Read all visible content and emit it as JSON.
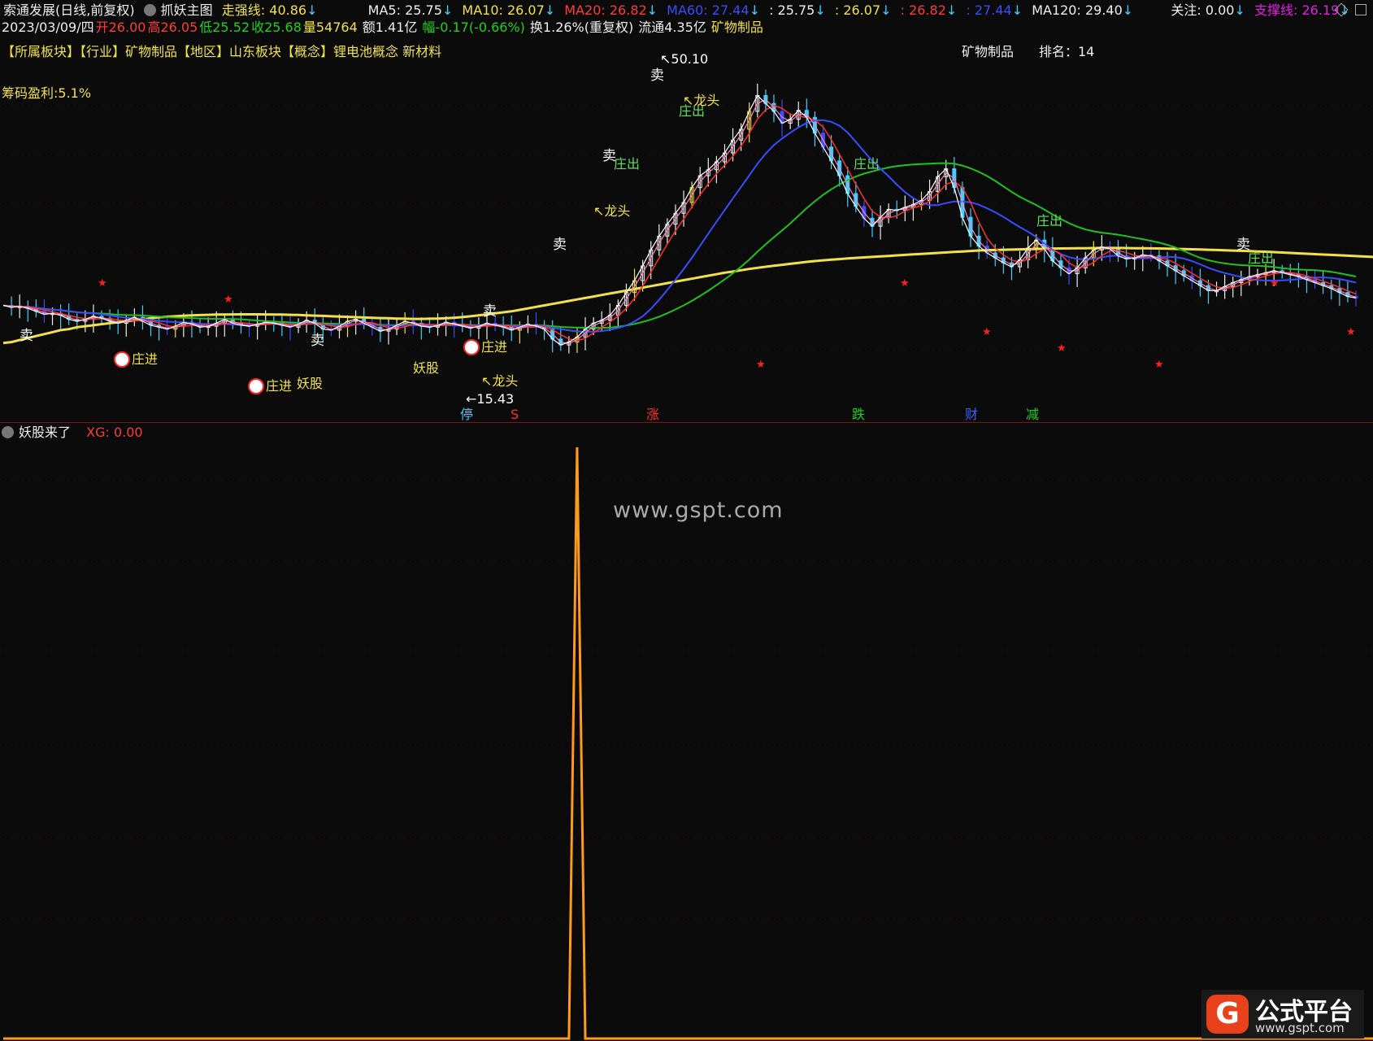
{
  "header": {
    "title": "索通发展(日线,前复权)",
    "indicator": "抓妖主图",
    "strong_line": {
      "label": "走强线: 40.86",
      "arrow": "↓"
    },
    "ma5": {
      "label": "MA5: 25.75",
      "arrow": "↓"
    },
    "ma10": {
      "label": "MA10: 26.07",
      "arrow": "↓"
    },
    "ma20": {
      "label": "MA20: 26.82",
      "arrow": "↓"
    },
    "ma60": {
      "label": "MA60: 27.44",
      "arrow": "↓"
    },
    "v1": {
      "label": ": 25.75",
      "arrow": "↓"
    },
    "v2": {
      "label": ": 26.07",
      "arrow": "↓"
    },
    "v3": {
      "label": ": 26.82",
      "arrow": "↓"
    },
    "v4": {
      "label": ": 27.44",
      "arrow": "↓"
    },
    "ma120": {
      "label": "MA120: 29.40",
      "arrow": "↓"
    },
    "focus": {
      "label": "关注: 0.00",
      "arrow": "↓"
    },
    "support": {
      "label": "支撑线: 26.19",
      "arrow": "↓"
    }
  },
  "quote": {
    "date": "2023/03/09/四",
    "open": "开26.00",
    "high": "高26.05",
    "low": "低25.52",
    "close": "收25.68",
    "volume": "量54764",
    "amount": "额1.41亿",
    "change": "幅-0.17(-0.66%)",
    "turnover": "换1.26%(重复权)",
    "float_cap": "流通4.35亿",
    "sector": "矿物制品"
  },
  "info": {
    "line": "【所属板块】【行业】矿物制品【地区】山东板块【概念】锂电池概念 新材料",
    "industry": "矿物制品",
    "rank": "排名：14",
    "chip_profit": "筹码盈利:5.1%"
  },
  "annotations": {
    "high_price": "50.10",
    "low_price": "15.43",
    "sell": "卖",
    "dealer_in": "庄进",
    "dealer_out": "庄出",
    "dragon_head": "龙头",
    "monster": "妖股",
    "bottom_markers": [
      "停",
      "S",
      "涨",
      "跌",
      "财",
      "减"
    ]
  },
  "sub_panel": {
    "name": "妖股来了",
    "value_label": "XG: 0.00"
  },
  "watermark": "www.gspt.com",
  "logo": {
    "name": "公式平台",
    "url": "www.gspt.com"
  },
  "colors": {
    "up": "#ff3b3b",
    "down": "#40d0ff",
    "ma5": "#ffffff",
    "ma10": "#f2e14a",
    "ma20": "#ff3030",
    "ma60": "#3a4cff",
    "ma120": "#20c020",
    "strong": "#f2e14a",
    "signal": "#ff9a1a"
  },
  "chart_data": [
    {
      "type": "line",
      "name": "price",
      "series": [
        {
          "name": "MA5",
          "values": [
            25.0,
            24.8,
            24.9,
            24.7,
            24.4,
            24.1,
            24.2,
            24.0,
            23.6,
            23.4,
            23.6,
            23.9,
            23.7,
            23.4,
            23.2,
            23.5,
            23.8,
            23.4,
            23.0,
            22.8,
            22.6,
            22.9,
            23.3,
            23.1,
            22.8,
            22.9,
            23.2,
            23.6,
            23.2,
            23.0,
            22.9,
            23.1,
            23.3,
            23.2,
            23.0,
            22.8,
            23.1,
            23.5,
            23.2,
            22.6,
            22.5,
            22.9,
            23.4,
            23.6,
            23.2,
            22.8,
            22.4,
            22.6,
            23.0,
            23.4,
            23.2,
            22.9,
            22.8,
            23.0,
            23.3,
            23.1,
            22.9,
            22.7,
            22.9,
            23.2,
            23.0,
            22.8,
            22.5,
            22.8,
            23.1,
            22.9,
            22.6,
            21.6,
            21.0,
            21.3,
            21.8,
            22.6,
            23.2,
            23.5,
            24.0,
            25.0,
            26.3,
            27.5,
            29.0,
            30.6,
            32.0,
            33.2,
            34.3,
            35.4,
            36.9,
            38.1,
            38.7,
            39.5,
            40.4,
            41.7,
            42.8,
            44.6,
            46.2,
            45.4,
            44.6,
            43.4,
            43.8,
            44.7,
            44.0,
            42.4,
            41.0,
            39.6,
            38.1,
            36.3,
            35.0,
            33.8,
            33.0,
            33.9,
            34.7,
            34.6,
            34.9,
            35.2,
            35.6,
            36.5,
            38.0,
            38.8,
            36.9,
            33.9,
            32.0,
            31.0,
            30.3,
            29.8,
            29.3,
            28.9,
            29.6,
            30.8,
            31.6,
            30.7,
            29.5,
            28.8,
            28.2,
            28.8,
            29.8,
            30.6,
            30.9,
            30.7,
            30.0,
            29.7,
            29.8,
            30.1,
            30.0,
            29.5,
            29.0,
            28.5,
            28.0,
            27.5,
            27.0,
            26.5,
            26.5,
            26.9,
            27.3,
            27.6,
            27.9,
            28.1,
            28.3,
            28.5,
            28.3,
            28.1,
            27.9,
            27.6,
            27.3,
            27.0,
            26.7,
            26.3,
            25.9,
            25.75
          ]
        },
        {
          "name": "MA120",
          "values": [
            21.2,
            21.3,
            21.5,
            21.7,
            21.9,
            22.1,
            22.3,
            22.5,
            22.6,
            22.8,
            22.9,
            23.0,
            23.1,
            23.2,
            23.3,
            23.4,
            23.5,
            23.6,
            23.7,
            23.8,
            23.85,
            23.9,
            23.95,
            24.0,
            24.02,
            24.05,
            24.07,
            24.08,
            24.09,
            24.1,
            24.1,
            24.1,
            24.09,
            24.08,
            24.07,
            24.05,
            24.03,
            24.0,
            23.97,
            23.94,
            23.9,
            23.87,
            23.84,
            23.81,
            23.78,
            23.75,
            23.72,
            23.7,
            23.67,
            23.65,
            23.64,
            23.64,
            23.65,
            23.67,
            23.7,
            23.75,
            23.82,
            23.9,
            24.0,
            24.1,
            24.2,
            24.3,
            24.4,
            24.55,
            24.7,
            24.85,
            25.0,
            25.15,
            25.3,
            25.45,
            25.6,
            25.75,
            25.9,
            26.05,
            26.2,
            26.35,
            26.5,
            26.65,
            26.8,
            26.95,
            27.1,
            27.25,
            27.4,
            27.55,
            27.7,
            27.85,
            28.0,
            28.15,
            28.3,
            28.42,
            28.55,
            28.68,
            28.8,
            28.9,
            29.0,
            29.1,
            29.2,
            29.3,
            29.4,
            29.48,
            29.55,
            29.62,
            29.68,
            29.74,
            29.8,
            29.85,
            29.9,
            29.95,
            30.0,
            30.05,
            30.1,
            30.15,
            30.2,
            30.25,
            30.3,
            30.35,
            30.4,
            30.45,
            30.5,
            30.55,
            30.58,
            30.6,
            30.62,
            30.64,
            30.66,
            30.68,
            30.7,
            30.72,
            30.74,
            30.75,
            30.76,
            30.77,
            30.78,
            30.79,
            30.8,
            30.8,
            30.8,
            30.79,
            30.78,
            30.77,
            30.76,
            30.75,
            30.73,
            30.71,
            30.69,
            30.67,
            30.65,
            30.62,
            30.6,
            30.57,
            30.54,
            30.51,
            30.48,
            30.45,
            30.42,
            30.38,
            30.34,
            30.3,
            30.26,
            30.22,
            30.18,
            30.14,
            30.1,
            30.06,
            30.02,
            29.98,
            29.94,
            29.9,
            29.86,
            29.82,
            29.78,
            29.74,
            29.7
          ]
        }
      ],
      "y_range": [
        15.43,
        50.1
      ]
    },
    {
      "type": "line",
      "name": "妖股来了",
      "series": [
        {
          "name": "XG",
          "values": [
            0,
            0,
            0,
            0,
            0,
            0,
            0,
            0,
            0,
            0,
            0,
            0,
            0,
            0,
            0,
            0,
            0,
            0,
            0,
            0,
            0,
            0,
            0,
            0,
            0,
            0,
            0,
            0,
            0,
            0,
            0,
            0,
            0,
            0,
            0,
            0,
            0,
            0,
            0,
            0,
            0,
            0,
            0,
            0,
            0,
            0,
            0,
            0,
            0,
            0,
            0,
            0,
            0,
            0,
            0,
            0,
            0,
            0,
            0,
            0,
            0,
            0,
            0,
            0,
            0,
            0,
            0,
            0,
            0,
            0,
            1,
            0,
            0,
            0,
            0,
            0,
            0,
            0,
            0,
            0,
            0,
            0,
            0,
            0,
            0,
            0,
            0,
            0,
            0,
            0,
            0,
            0,
            0,
            0,
            0,
            0,
            0,
            0,
            0,
            0,
            0,
            0,
            0,
            0,
            0,
            0,
            0,
            0,
            0,
            0,
            0,
            0,
            0,
            0,
            0,
            0,
            0,
            0,
            0,
            0,
            0,
            0,
            0,
            0,
            0,
            0,
            0,
            0,
            0,
            0,
            0,
            0,
            0,
            0,
            0,
            0,
            0,
            0,
            0,
            0,
            0,
            0,
            0,
            0,
            0,
            0,
            0,
            0,
            0,
            0,
            0,
            0,
            0,
            0,
            0,
            0,
            0,
            0,
            0,
            0,
            0,
            0,
            0,
            0,
            0,
            0,
            0,
            0,
            0,
            0
          ]
        }
      ]
    }
  ]
}
